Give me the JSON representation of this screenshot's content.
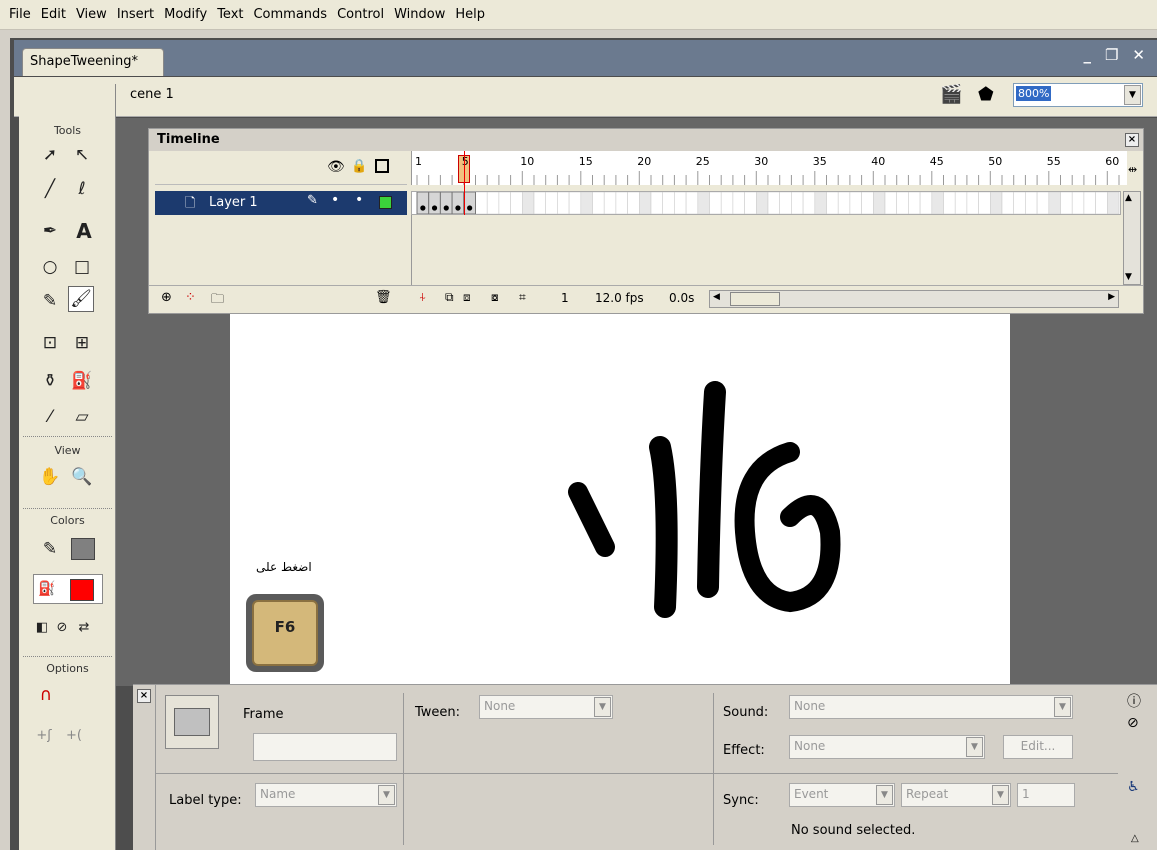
{
  "menu": [
    "File",
    "Edit",
    "View",
    "Insert",
    "Modify",
    "Text",
    "Commands",
    "Control",
    "Window",
    "Help"
  ],
  "document": {
    "tab_title": "ShapeTweening*",
    "scene_label": "cene 1",
    "zoom": "800%"
  },
  "tools": {
    "title": "Tools",
    "view": "View",
    "colors": "Colors",
    "options": "Options",
    "stroke_color": "#808080",
    "fill_color": "#ff0000"
  },
  "timeline": {
    "title": "Timeline",
    "ruler_labels": [
      "1",
      "5",
      "10",
      "15",
      "20",
      "25",
      "30",
      "35",
      "40",
      "45",
      "50",
      "55",
      "60"
    ],
    "layer_name": "Layer 1",
    "current_frame": "1",
    "fps": "12.0 fps",
    "time": "0.0s",
    "playhead_frame": 5
  },
  "stage": {
    "hint_text": "اضغط على",
    "key_label": "F6"
  },
  "properties": {
    "frame_label": "Frame",
    "tween_label": "Tween:",
    "tween_value": "None",
    "label_type_label": "Label type:",
    "label_type_value": "Name",
    "sound_label": "Sound:",
    "sound_value": "None",
    "effect_label": "Effect:",
    "effect_value": "None",
    "edit_button": "Edit...",
    "sync_label": "Sync:",
    "sync_value": "Event",
    "repeat_value": "Repeat",
    "repeat_count": "1",
    "sound_status": "No sound selected."
  }
}
